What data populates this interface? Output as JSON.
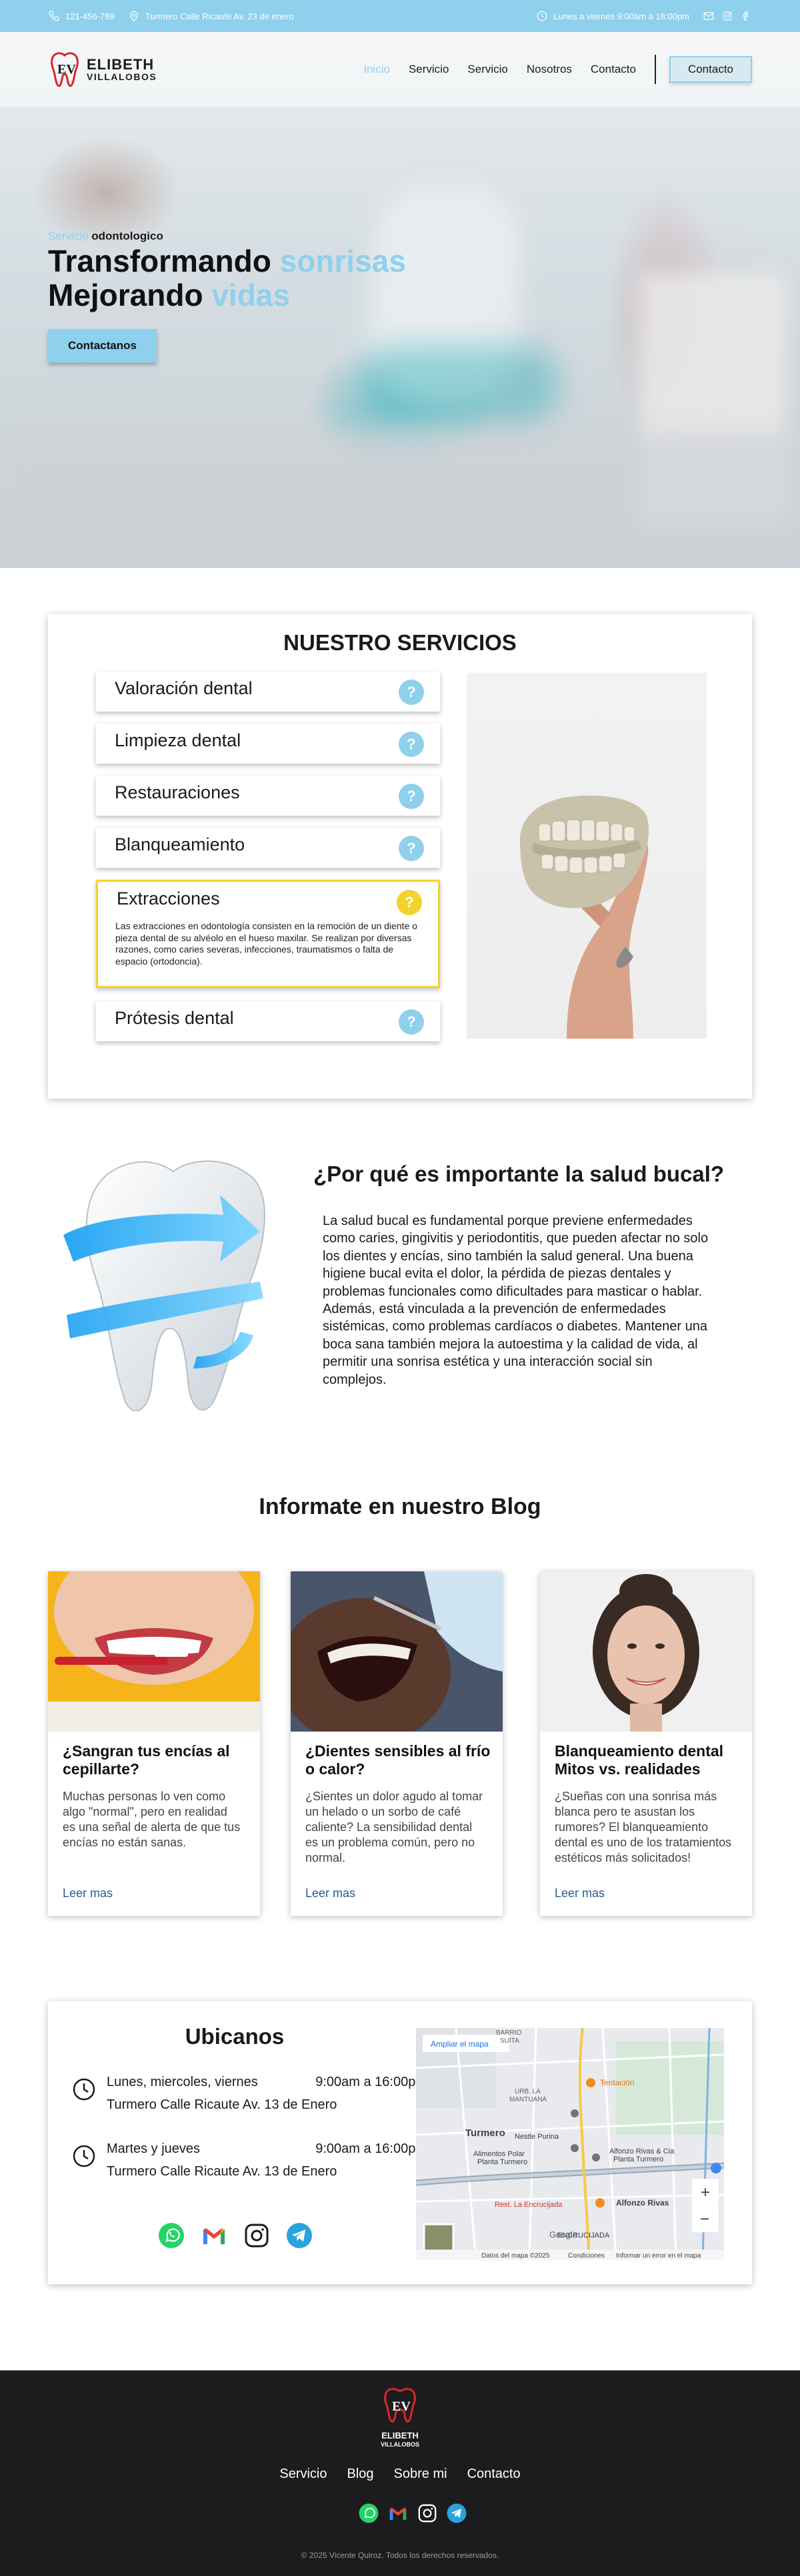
{
  "topbar": {
    "phone": "121-456-789",
    "address": "Turmero Calle Ricaute Av. 23 de enero",
    "hours": "Lunes a viernes 9:00am a 18:00pm"
  },
  "brand": {
    "name_line1": "ELIBETH",
    "name_line2": "VILLALOBOS",
    "mark_letters": "EV"
  },
  "nav": {
    "items": [
      "Inicio",
      "Servicio",
      "Servicio",
      "Nosotros",
      "Contacto"
    ],
    "cta": "Contacto"
  },
  "hero": {
    "kicker_light": "Servicio",
    "kicker_dark": "odontologico",
    "line1_dark": "Transformando",
    "line1_light": "sonrisas",
    "line2_dark": "Mejorando",
    "line2_light": "vidas",
    "button": "Contactanos"
  },
  "services": {
    "title": "NUESTRO SERVICIOS",
    "items": [
      {
        "label": "Valoración dental",
        "icon": "?"
      },
      {
        "label": "Limpieza dental",
        "icon": "?"
      },
      {
        "label": "Restauraciones",
        "icon": "?"
      },
      {
        "label": "Blanqueamiento",
        "icon": "?"
      },
      {
        "label": "Extracciones",
        "icon": "?",
        "description": "Las extracciones en odontología consisten en la remoción de un diente o pieza dental de su alvéolo en el hueso maxilar. Se realizan por diversas razones, como caries severas, infecciones, traumatismos o falta de espacio (ortodoncia)."
      },
      {
        "label": "Prótesis dental",
        "icon": "?"
      }
    ]
  },
  "why": {
    "title": "¿Por qué es importante la salud bucal?",
    "body": "La salud bucal es fundamental porque previene enfermedades como caries, gingivitis y periodontitis, que pueden afectar no solo los dientes y encías, sino también la salud general. Una buena higiene bucal evita el dolor, la pérdida de piezas dentales y problemas funcionales como dificultades para masticar o hablar. Además, está vinculada a la prevención de enfermedades sistémicas, como problemas cardíacos o diabetes. Mantener una boca sana también mejora la autoestima y la calidad de vida, al permitir una sonrisa estética y una interacción social sin complejos."
  },
  "blog": {
    "title": "Informate  en  nuestro Blog",
    "posts": [
      {
        "title": "¿Sangran tus encías al cepillarte?",
        "excerpt": "Muchas personas lo ven como algo \"normal\", pero en realidad es una señal de alerta de que tus encías no están sanas.",
        "link": "Leer mas"
      },
      {
        "title": "¿Dientes sensibles al frío o calor?",
        "excerpt": "¿Sientes un dolor agudo al tomar un helado o un sorbo de café caliente? La sensibilidad dental es un problema común, pero no normal.",
        "link": "Leer mas"
      },
      {
        "title": "Blanqueamiento dental Mitos vs. realidades",
        "excerpt": "¿Sueñas con una sonrisa más blanca pero te asustan los rumores? El blanqueamiento dental es uno de los tratamientos estéticos más solicitados!",
        "link": "Leer mas"
      }
    ]
  },
  "location": {
    "title": "Ubicanos",
    "schedules": [
      {
        "days": "Lunes, miercoles, viernes",
        "time": "9:00am a 16:00pm",
        "address": "Turmero Calle Ricaute Av. 13 de Enero"
      },
      {
        "days": "Martes y jueves",
        "time": "9:00am a 16:00pm",
        "address": "Turmero Calle Ricaute Av. 13 de Enero"
      }
    ],
    "map": {
      "expand": "Ampliar el mapa",
      "labels": [
        "BARRIO",
        "SUITA",
        "URB. LA",
        "MANTUANA",
        "Turmero",
        "Nestle Purina",
        "Alimentos Polar",
        "Planta Turmero",
        "Tentación",
        "Alfonzo Rivas & Cia",
        "Planta Turmero",
        "Rest. La Encrucijada",
        "Alfonzo Rivas",
        "ENCRUCIJADA",
        "Google"
      ],
      "zoom_in": "+",
      "zoom_out": "−",
      "footer": [
        "Datos del mapa ©2025",
        "Condiciones",
        "Informar un error en el mapa"
      ]
    }
  },
  "footer": {
    "links": [
      "Servicio",
      "Blog",
      "Sobre mi",
      "Contacto"
    ],
    "copyright": "© 2025 Vicente Quiroz. Todos los derechos reservados."
  },
  "colors": {
    "accent": "#8fd0ec",
    "highlight": "#f3d32b",
    "dark": "#1c1c1e",
    "link": "#2a5a95"
  }
}
